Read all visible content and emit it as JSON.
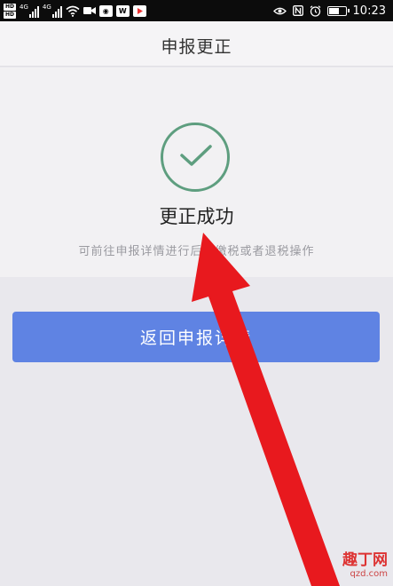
{
  "status_bar": {
    "hd_labels": [
      "HD",
      "HD"
    ],
    "network_labels": [
      "4G",
      "4G"
    ],
    "time": "10:23"
  },
  "header": {
    "title": "申报更正"
  },
  "result": {
    "title": "更正成功",
    "hint": "可前往申报详情进行后续缴税或者退税操作"
  },
  "actions": {
    "back_to_details_label": "返回申报详情"
  },
  "overlay": {
    "watermark_main": "趣丁网",
    "watermark_url": "qzd.com"
  },
  "colors": {
    "status_bar_bg": "#0c0c0c",
    "success_green": "#5e9e7f",
    "primary_button": "#5f83e3",
    "annotation_arrow": "#e8191e"
  }
}
